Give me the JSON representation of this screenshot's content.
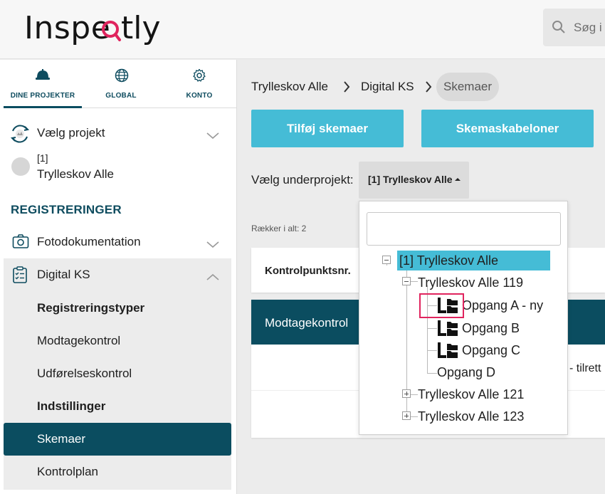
{
  "header": {
    "logo_text": "Inspectly",
    "search_placeholder": "Søg i"
  },
  "sidebar": {
    "tabs": [
      {
        "label": "DINE PROJEKTER",
        "icon": "helmet-icon",
        "active": true
      },
      {
        "label": "GLOBAL",
        "icon": "globe-icon",
        "active": false
      },
      {
        "label": "KONTO",
        "icon": "gear-icon",
        "active": false
      }
    ],
    "project_selector": {
      "label": "Vælg projekt",
      "icon": "project-sync-icon"
    },
    "subproject": {
      "id": "[1]",
      "name": "Trylleskov Alle"
    },
    "section_title": "REGISTRERINGER",
    "nav": {
      "foto": {
        "label": "Fotodokumentation",
        "icon": "camera-icon"
      },
      "digital_ks": {
        "label": "Digital KS",
        "icon": "clipboard-icon"
      },
      "sub_items": [
        {
          "label": "Registreringstyper",
          "bold": true
        },
        {
          "label": "Modtagekontrol",
          "bold": false
        },
        {
          "label": "Udførelseskontrol",
          "bold": false
        },
        {
          "label": "Indstillinger",
          "bold": true
        },
        {
          "label": "Skemaer",
          "selected": true
        },
        {
          "label": "Kontrolplan",
          "bold": false
        }
      ]
    }
  },
  "main": {
    "breadcrumb": [
      "Trylleskov Alle",
      "Digital KS",
      "Skemaer"
    ],
    "buttons": {
      "add": "Tilføj skemaer",
      "templates": "Skemaskabeloner"
    },
    "subproject_label": "Vælg underprojekt:",
    "subproject_value": "[1] Trylleskov Alle",
    "rows_count": "Rækker i alt: 2",
    "table_header": "Kontrolpunktsnr.",
    "group_row": "Modtagekontrol",
    "row_tail_text": "- tilrett"
  },
  "dropdown": {
    "search_value": "",
    "tree": {
      "root": "[1] Trylleskov Alle",
      "level1": [
        "Trylleskov Alle 119",
        "Trylleskov Alle 121",
        "Trylleskov Alle 123"
      ],
      "level2": [
        "Opgang A - ny",
        "Opgang B",
        "Opgang C",
        "Opgang D"
      ]
    }
  },
  "colors": {
    "primary_dark": "#0b4d60",
    "accent": "#45bcd6",
    "highlight_box": "#e0245e"
  }
}
